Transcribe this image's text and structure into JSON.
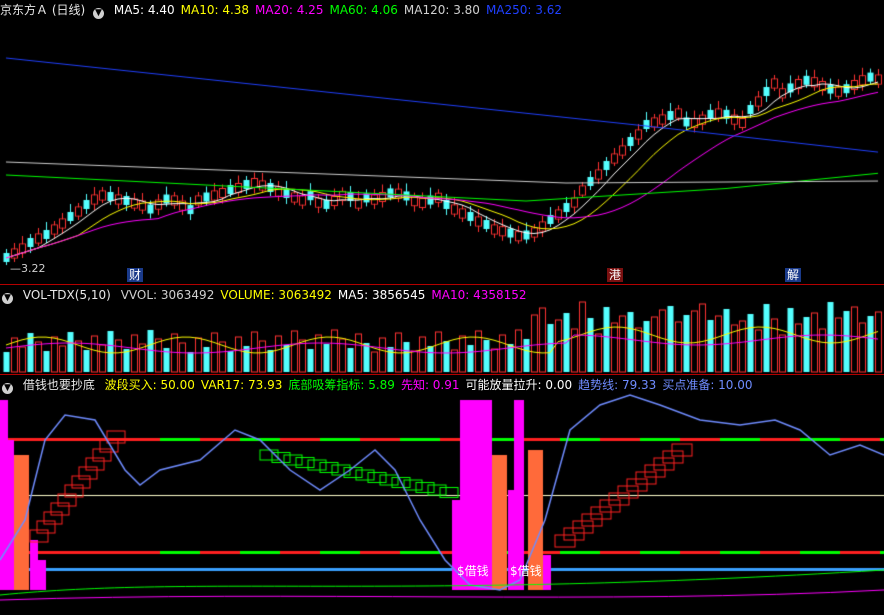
{
  "panel_main": {
    "title": "京东方Ａ (日线)",
    "indicators": [
      {
        "label": "MA5: 4.40",
        "color": "#ffffff"
      },
      {
        "label": "MA10: 4.38",
        "color": "#ffff00"
      },
      {
        "label": "MA20: 4.25",
        "color": "#ff00ff"
      },
      {
        "label": "MA60: 4.06",
        "color": "#00ff00"
      },
      {
        "label": "MA120: 3.80",
        "color": "#d0d0d0"
      },
      {
        "label": "MA250: 3.62",
        "color": "#2040ff"
      }
    ],
    "low_label": "3.22",
    "events": [
      "财",
      "港",
      "解"
    ]
  },
  "panel_volume": {
    "title": "VOL-TDX(5,10)",
    "indicators": [
      {
        "label": "VVOL: 3063492",
        "color": "#d0d0d0"
      },
      {
        "label": "VOLUME: 3063492",
        "color": "#ffff00"
      },
      {
        "label": "MA5: 3856545",
        "color": "#ffffff"
      },
      {
        "label": "MA10: 4358152",
        "color": "#ff00ff"
      }
    ]
  },
  "panel_indicator": {
    "title": "借钱也要抄底",
    "indicators": [
      {
        "label": "波段买入: 50.00",
        "color": "#ffff00"
      },
      {
        "label": "VAR17: 73.93",
        "color": "#ffff00"
      },
      {
        "label": "底部吸筹指标: 5.89",
        "color": "#00ff00"
      },
      {
        "label": "先知: 0.91",
        "color": "#ff00ff"
      },
      {
        "label": "可能放量拉升: 0.00",
        "color": "#ffffff"
      },
      {
        "label": "趋势线: 79.33",
        "color": "#6f8cff"
      },
      {
        "label": "买点准备: 10.00",
        "color": "#6f8cff"
      }
    ],
    "signal_label": "$借钱"
  },
  "colors": {
    "up": "#ff3232",
    "down": "#54ffff",
    "ma5": "#ffffff",
    "ma10": "#ffff00",
    "ma20": "#ff00ff",
    "ma60": "#00ff00",
    "ma120": "#d0d0d0",
    "ma250": "#2040ff",
    "trend": "#6f8cff",
    "magenta": "#ff00ff",
    "orange": "#ff6a3a",
    "level_red": "#ff2020",
    "level_green": "#00ff00",
    "level_blue": "#3aa0ff"
  }
}
